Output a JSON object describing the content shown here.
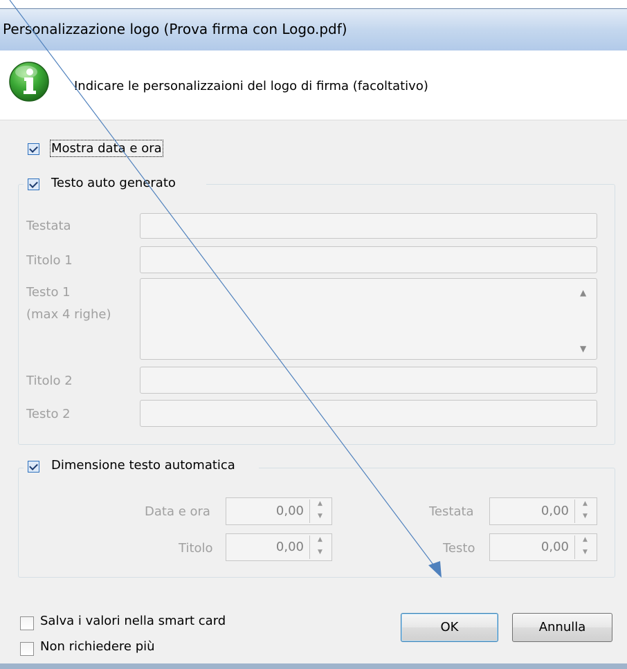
{
  "window": {
    "title": "Personalizzazione logo (Prova firma con Logo.pdf)"
  },
  "header": {
    "text": "Indicare le personalizzaioni del logo di firma (facoltativo)",
    "icon": "info-icon",
    "icon_color": "#3aa835"
  },
  "options": {
    "show_datetime_label": "Mostra data e ora",
    "show_datetime_checked": true,
    "auto_text_label": "Testo auto generato",
    "auto_text_checked": true
  },
  "auto_text": {
    "testata_label": "Testata",
    "testata_value": "",
    "titolo1_label": "Titolo 1",
    "titolo1_value": "",
    "testo1_label_line1": "Testo 1",
    "testo1_label_line2": "(max 4 righe)",
    "testo1_value": "",
    "titolo2_label": "Titolo 2",
    "titolo2_value": "",
    "testo2_label": "Testo 2",
    "testo2_value": ""
  },
  "auto_size": {
    "label": "Dimensione testo automatica",
    "checked": true,
    "data_ora_label": "Data e ora",
    "data_ora_value": "0,00",
    "titolo_label": "Titolo",
    "titolo_value": "0,00",
    "testata_label": "Testata",
    "testata_value": "0,00",
    "testo_label": "Testo",
    "testo_value": "0,00"
  },
  "footer": {
    "save_smartcard_label": "Salva i valori nella smart card",
    "save_smartcard_checked": false,
    "dont_ask_label": "Non richiedere più",
    "dont_ask_checked": false,
    "ok_label": "OK",
    "cancel_label": "Annulla"
  },
  "annotation": {
    "arrow_color": "#4f81bd"
  }
}
